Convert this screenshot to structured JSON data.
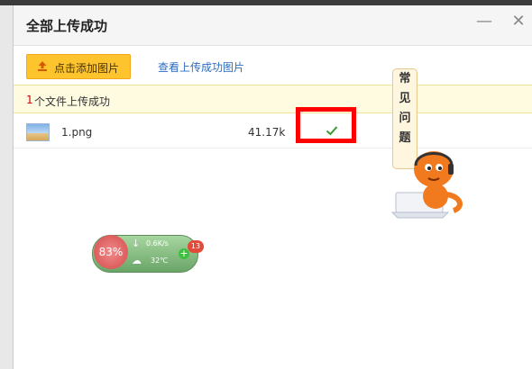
{
  "dialog": {
    "title": "全部上传成功",
    "minimize_icon": "—",
    "close_icon": "✕"
  },
  "toolbar": {
    "add_button_label": "点击添加图片",
    "view_link_label": "查看上传成功图片"
  },
  "status": {
    "count": "1",
    "text": "个文件上传成功"
  },
  "files": [
    {
      "name": "1.png",
      "size": "41.17k",
      "status_icon": "check-icon"
    }
  ],
  "help": {
    "chars": [
      "常",
      "见",
      "问",
      "题"
    ]
  },
  "widget": {
    "cpu": "83%",
    "speed": "0.6K/s",
    "temp": "32℃",
    "badge": "13"
  },
  "colors": {
    "accent_yellow": "#fec42d",
    "link_blue": "#2d6cc0",
    "success_green": "#3a9a32",
    "highlight_red": "#ff0000"
  }
}
